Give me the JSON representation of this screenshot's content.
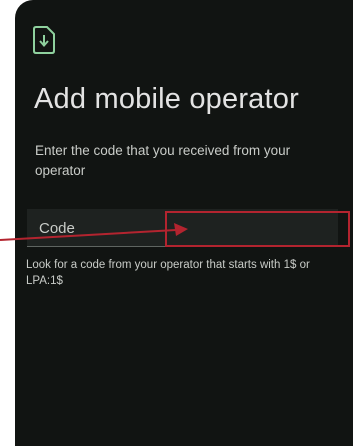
{
  "header": {
    "icon": "sim-download-icon"
  },
  "title": "Add mobile operator",
  "description": "Enter the code that you received from your operator",
  "code_field": {
    "placeholder": "Code",
    "value": ""
  },
  "helper_text": "Look for a code from your operator that starts with 1$ or LPA:1$",
  "annotation": {
    "color": "#b3242f"
  }
}
